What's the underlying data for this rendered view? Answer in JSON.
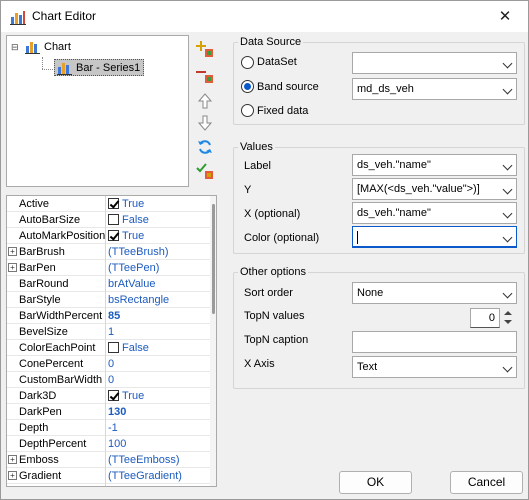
{
  "window": {
    "title": "Chart Editor",
    "close_glyph": "✕"
  },
  "tree": {
    "expander": "⊟",
    "root_label": "Chart",
    "child_label": "Bar - Series1"
  },
  "toolbar": {
    "icons": [
      "add-series-icon",
      "delete-series-icon",
      "move-up-icon",
      "move-down-icon",
      "refresh-icon",
      "validate-icon"
    ]
  },
  "properties": [
    {
      "name": "Active",
      "value": "True",
      "kind": "check",
      "checked": true
    },
    {
      "name": "AutoBarSize",
      "value": "False",
      "kind": "check",
      "checked": false
    },
    {
      "name": "AutoMarkPosition",
      "value": "True",
      "kind": "check",
      "checked": true
    },
    {
      "name": "BarBrush",
      "value": "(TTeeBrush)",
      "kind": "sub"
    },
    {
      "name": "BarPen",
      "value": "(TTeePen)",
      "kind": "sub"
    },
    {
      "name": "BarRound",
      "value": "brAtValue",
      "kind": "text"
    },
    {
      "name": "BarStyle",
      "value": "bsRectangle",
      "kind": "text"
    },
    {
      "name": "BarWidthPercent",
      "value": "85",
      "kind": "bold"
    },
    {
      "name": "BevelSize",
      "value": "1",
      "kind": "text"
    },
    {
      "name": "ColorEachPoint",
      "value": "False",
      "kind": "check",
      "checked": false
    },
    {
      "name": "ConePercent",
      "value": "0",
      "kind": "text"
    },
    {
      "name": "CustomBarWidth",
      "value": "0",
      "kind": "text"
    },
    {
      "name": "Dark3D",
      "value": "True",
      "kind": "check",
      "checked": true
    },
    {
      "name": "DarkPen",
      "value": "130",
      "kind": "bold"
    },
    {
      "name": "Depth",
      "value": "-1",
      "kind": "text"
    },
    {
      "name": "DepthPercent",
      "value": "100",
      "kind": "text"
    },
    {
      "name": "Emboss",
      "value": "(TTeeEmboss)",
      "kind": "sub"
    },
    {
      "name": "Gradient",
      "value": "(TTeeGradient)",
      "kind": "sub"
    },
    {
      "name": "",
      "value": "",
      "kind": "text"
    }
  ],
  "data_source": {
    "label": "Data Source",
    "dataset_label": "DataSet",
    "dataset_value": "",
    "band_label": "Band source",
    "band_value": "md_ds_veh",
    "fixed_label": "Fixed data",
    "selected": "band"
  },
  "values": {
    "label": "Values",
    "label_field": "Label",
    "label_value": "ds_veh.\"name\"",
    "y_field": "Y",
    "y_value": "[MAX(<ds_veh.\"value\">)]",
    "x_field": "X (optional)",
    "x_value": "ds_veh.\"name\"",
    "color_field": "Color (optional)",
    "color_value": ""
  },
  "other": {
    "label": "Other options",
    "sort_label": "Sort order",
    "sort_value": "None",
    "topn_label": "TopN values",
    "topn_value": "0",
    "topn_caption_label": "TopN caption",
    "topn_caption_value": "",
    "xaxis_label": "X Axis",
    "xaxis_value": "Text"
  },
  "buttons": {
    "ok": "OK",
    "cancel": "Cancel"
  },
  "colors": {
    "accent": "#0a58ca",
    "value_text": "#1c5bbf"
  }
}
